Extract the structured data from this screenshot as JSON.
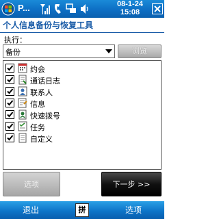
{
  "statusbar": {
    "app_short": "P...",
    "date": "08-1-24",
    "time": "15:08",
    "icons": [
      "windows-start-icon",
      "signal-icon",
      "volume-icon",
      "connectivity-icon",
      "close-icon"
    ]
  },
  "title": "个人信息备份与恢复工具",
  "exec_label": "执行：",
  "combo_value": "备份",
  "browse_label": "浏览",
  "items": [
    {
      "label": "约会",
      "checked": true,
      "icon": "calendar-icon"
    },
    {
      "label": "通话日志",
      "checked": true,
      "icon": "call-log-icon"
    },
    {
      "label": "联系人",
      "checked": true,
      "icon": "contacts-icon"
    },
    {
      "label": "信息",
      "checked": true,
      "icon": "message-icon"
    },
    {
      "label": "快速拨号",
      "checked": true,
      "icon": "speed-dial-icon"
    },
    {
      "label": "任务",
      "checked": true,
      "icon": "tasks-icon"
    },
    {
      "label": "自定义",
      "checked": true,
      "icon": "custom-icon"
    }
  ],
  "buttons": {
    "options": "选项",
    "next": "下一步 >>"
  },
  "softbar": {
    "left": "退出",
    "sip": "拼",
    "right": "选项"
  },
  "colors": {
    "accent": "#0d6fc4",
    "title_text": "#1a5ca8"
  }
}
